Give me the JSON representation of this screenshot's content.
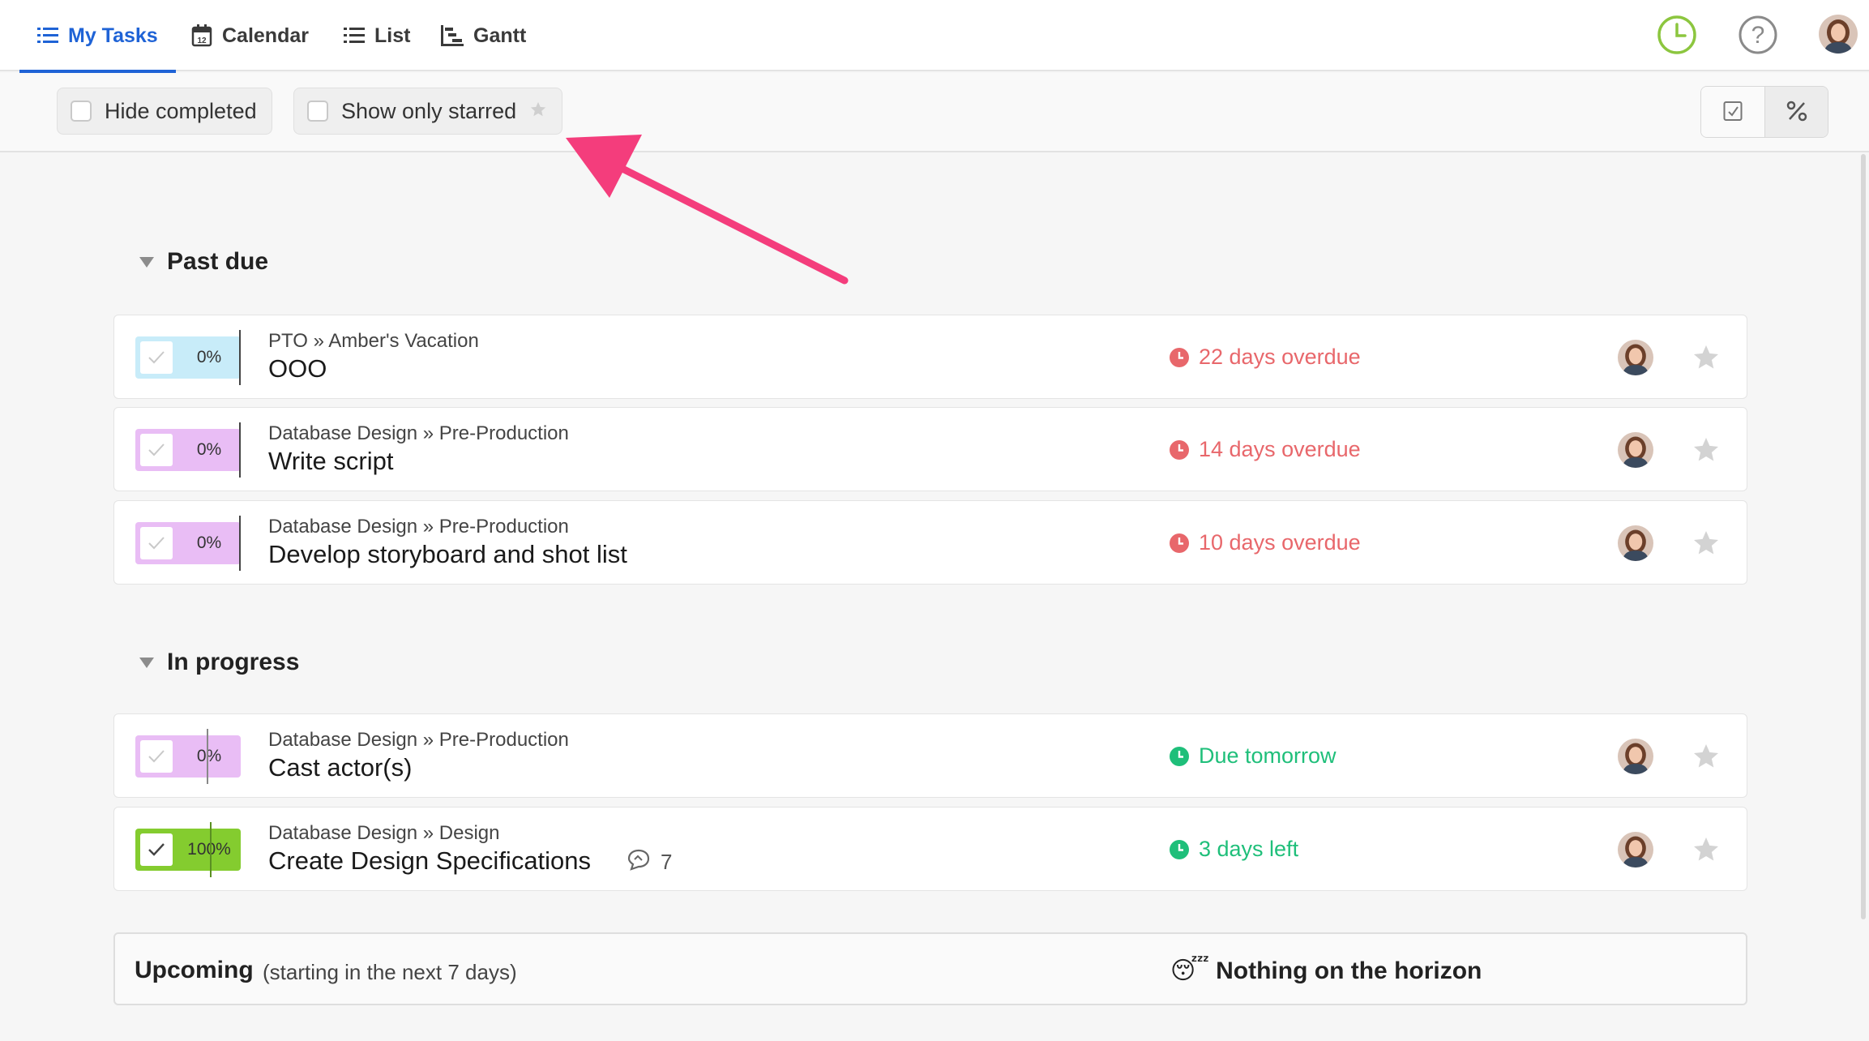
{
  "nav": {
    "tabs": [
      {
        "label": "My Tasks",
        "icon": "list-icon",
        "active": true
      },
      {
        "label": "Calendar",
        "icon": "calendar-icon",
        "active": false
      },
      {
        "label": "List",
        "icon": "list-icon",
        "active": false
      },
      {
        "label": "Gantt",
        "icon": "gantt-icon",
        "active": false
      }
    ],
    "calendar_day": "12",
    "right_icons": [
      "timer-icon",
      "help-icon",
      "user-avatar"
    ]
  },
  "toolbar": {
    "hide_completed": "Hide completed",
    "show_only_starred": "Show only starred",
    "view_toggle": [
      "checkbox-view-icon",
      "percent-view-icon"
    ]
  },
  "sections": {
    "past_due": {
      "title": "Past due",
      "tasks": [
        {
          "path": "PTO » Amber's Vacation",
          "name": "OOO",
          "progress": "0%",
          "progress_fraction": 0,
          "color": "#c8ecf9",
          "due": "22 days overdue",
          "due_status": "overdue",
          "starred": false
        },
        {
          "path": "Database Design » Pre-Production",
          "name": "Write script",
          "progress": "0%",
          "progress_fraction": 0,
          "color": "#e9bdf5",
          "due": "14 days overdue",
          "due_status": "overdue",
          "starred": false
        },
        {
          "path": "Database Design » Pre-Production",
          "name": "Develop storyboard and shot list",
          "progress": "0%",
          "progress_fraction": 0,
          "color": "#e9bdf5",
          "due": "10 days overdue",
          "due_status": "overdue",
          "starred": false
        }
      ]
    },
    "in_progress": {
      "title": "In progress",
      "tasks": [
        {
          "path": "Database Design » Pre-Production",
          "name": "Cast actor(s)",
          "progress": "0%",
          "progress_fraction": 0,
          "color": "#e9bdf5",
          "due": "Due tomorrow",
          "due_status": "ok",
          "starred": false
        },
        {
          "path": "Database Design » Design",
          "name": "Create Design Specifications",
          "progress": "100%",
          "progress_fraction": 1,
          "color": "#84cc2f",
          "due": "3 days left",
          "due_status": "ok",
          "starred": false,
          "comments": "7"
        }
      ]
    }
  },
  "upcoming": {
    "title": "Upcoming",
    "subtitle": "(starting in the next 7 days)",
    "empty_emoji": "😴",
    "empty_text": "Nothing on the horizon"
  },
  "colors": {
    "accent": "#1f63d6",
    "overdue": "#e8676b",
    "ok": "#1fbf7a",
    "timer": "#8cc63f",
    "annotation_arrow": "#f43d7c"
  }
}
